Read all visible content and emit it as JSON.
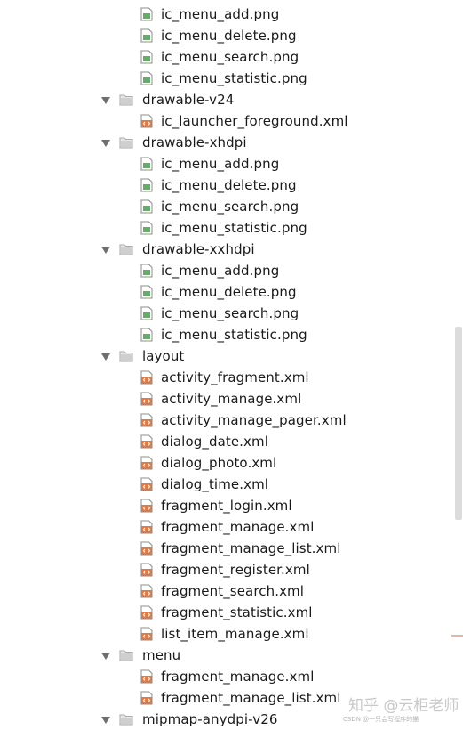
{
  "tree": [
    {
      "type": "file",
      "kind": "png",
      "label": "ic_menu_add.png"
    },
    {
      "type": "file",
      "kind": "png",
      "label": "ic_menu_delete.png"
    },
    {
      "type": "file",
      "kind": "png",
      "label": "ic_menu_search.png"
    },
    {
      "type": "file",
      "kind": "png",
      "label": "ic_menu_statistic.png"
    },
    {
      "type": "folder",
      "label": "drawable-v24"
    },
    {
      "type": "file",
      "kind": "xml",
      "label": "ic_launcher_foreground.xml"
    },
    {
      "type": "folder",
      "label": "drawable-xhdpi"
    },
    {
      "type": "file",
      "kind": "png",
      "label": "ic_menu_add.png"
    },
    {
      "type": "file",
      "kind": "png",
      "label": "ic_menu_delete.png"
    },
    {
      "type": "file",
      "kind": "png",
      "label": "ic_menu_search.png"
    },
    {
      "type": "file",
      "kind": "png",
      "label": "ic_menu_statistic.png"
    },
    {
      "type": "folder",
      "label": "drawable-xxhdpi"
    },
    {
      "type": "file",
      "kind": "png",
      "label": "ic_menu_add.png"
    },
    {
      "type": "file",
      "kind": "png",
      "label": "ic_menu_delete.png"
    },
    {
      "type": "file",
      "kind": "png",
      "label": "ic_menu_search.png"
    },
    {
      "type": "file",
      "kind": "png",
      "label": "ic_menu_statistic.png"
    },
    {
      "type": "folder",
      "label": "layout"
    },
    {
      "type": "file",
      "kind": "xml",
      "label": "activity_fragment.xml"
    },
    {
      "type": "file",
      "kind": "xml",
      "label": "activity_manage.xml"
    },
    {
      "type": "file",
      "kind": "xml",
      "label": "activity_manage_pager.xml"
    },
    {
      "type": "file",
      "kind": "xml",
      "label": "dialog_date.xml"
    },
    {
      "type": "file",
      "kind": "xml",
      "label": "dialog_photo.xml"
    },
    {
      "type": "file",
      "kind": "xml",
      "label": "dialog_time.xml"
    },
    {
      "type": "file",
      "kind": "xml",
      "label": "fragment_login.xml"
    },
    {
      "type": "file",
      "kind": "xml",
      "label": "fragment_manage.xml"
    },
    {
      "type": "file",
      "kind": "xml",
      "label": "fragment_manage_list.xml"
    },
    {
      "type": "file",
      "kind": "xml",
      "label": "fragment_register.xml"
    },
    {
      "type": "file",
      "kind": "xml",
      "label": "fragment_search.xml"
    },
    {
      "type": "file",
      "kind": "xml",
      "label": "fragment_statistic.xml"
    },
    {
      "type": "file",
      "kind": "xml",
      "label": "list_item_manage.xml"
    },
    {
      "type": "folder",
      "label": "menu"
    },
    {
      "type": "file",
      "kind": "xml",
      "label": "fragment_manage.xml"
    },
    {
      "type": "file",
      "kind": "xml",
      "label": "fragment_manage_list.xml"
    },
    {
      "type": "folder",
      "label": "mipmap-anydpi-v26"
    }
  ],
  "watermark": {
    "main": "知乎 @云柜老师",
    "sub": "CSDN @一只会写程序的猫"
  },
  "colors": {
    "folder": "#a9a9a9",
    "xml_icon": "#e07b46",
    "png_icon": "#6aaa6a",
    "arrow": "#6e6e6e"
  }
}
